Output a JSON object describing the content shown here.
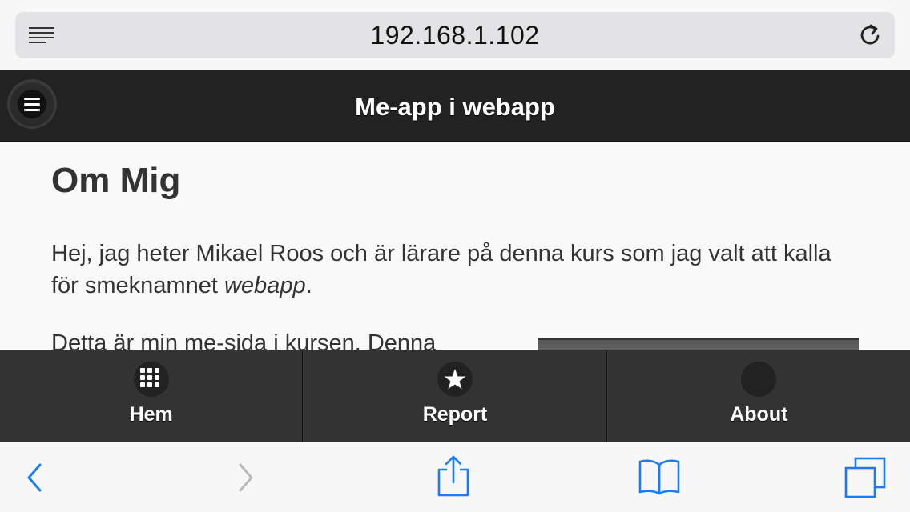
{
  "browser": {
    "url": "192.168.1.102",
    "icons": {
      "reader": "reader-list-icon",
      "reload": "reload-icon",
      "back": "back-chevron-icon",
      "forward": "forward-chevron-icon",
      "share": "share-icon",
      "bookmarks": "bookmarks-book-icon",
      "tabs": "tabs-icon"
    },
    "accent_color": "#1a7cf5",
    "disabled_color": "#b8b8bd"
  },
  "header": {
    "title": "Me-app i webapp",
    "menu_icon": "hamburger-menu-icon"
  },
  "content": {
    "heading": "Om Mig",
    "paragraph1_text": "Hej, jag heter Mikael Roos och är lärare på denna kurs som jag valt att kalla för smeknamnet ",
    "paragraph1_emphasis": "webapp",
    "paragraph1_end": ".",
    "paragraph2": "Detta är min me-sida i kursen. Denna"
  },
  "tabs": [
    {
      "label": "Hem",
      "icon": "grid-icon"
    },
    {
      "label": "Report",
      "icon": "star-icon"
    },
    {
      "label": "About",
      "icon": "circle-icon"
    }
  ],
  "colors": {
    "header_bg": "#222222",
    "tabbar_bg": "#333333",
    "text": "#333333"
  }
}
